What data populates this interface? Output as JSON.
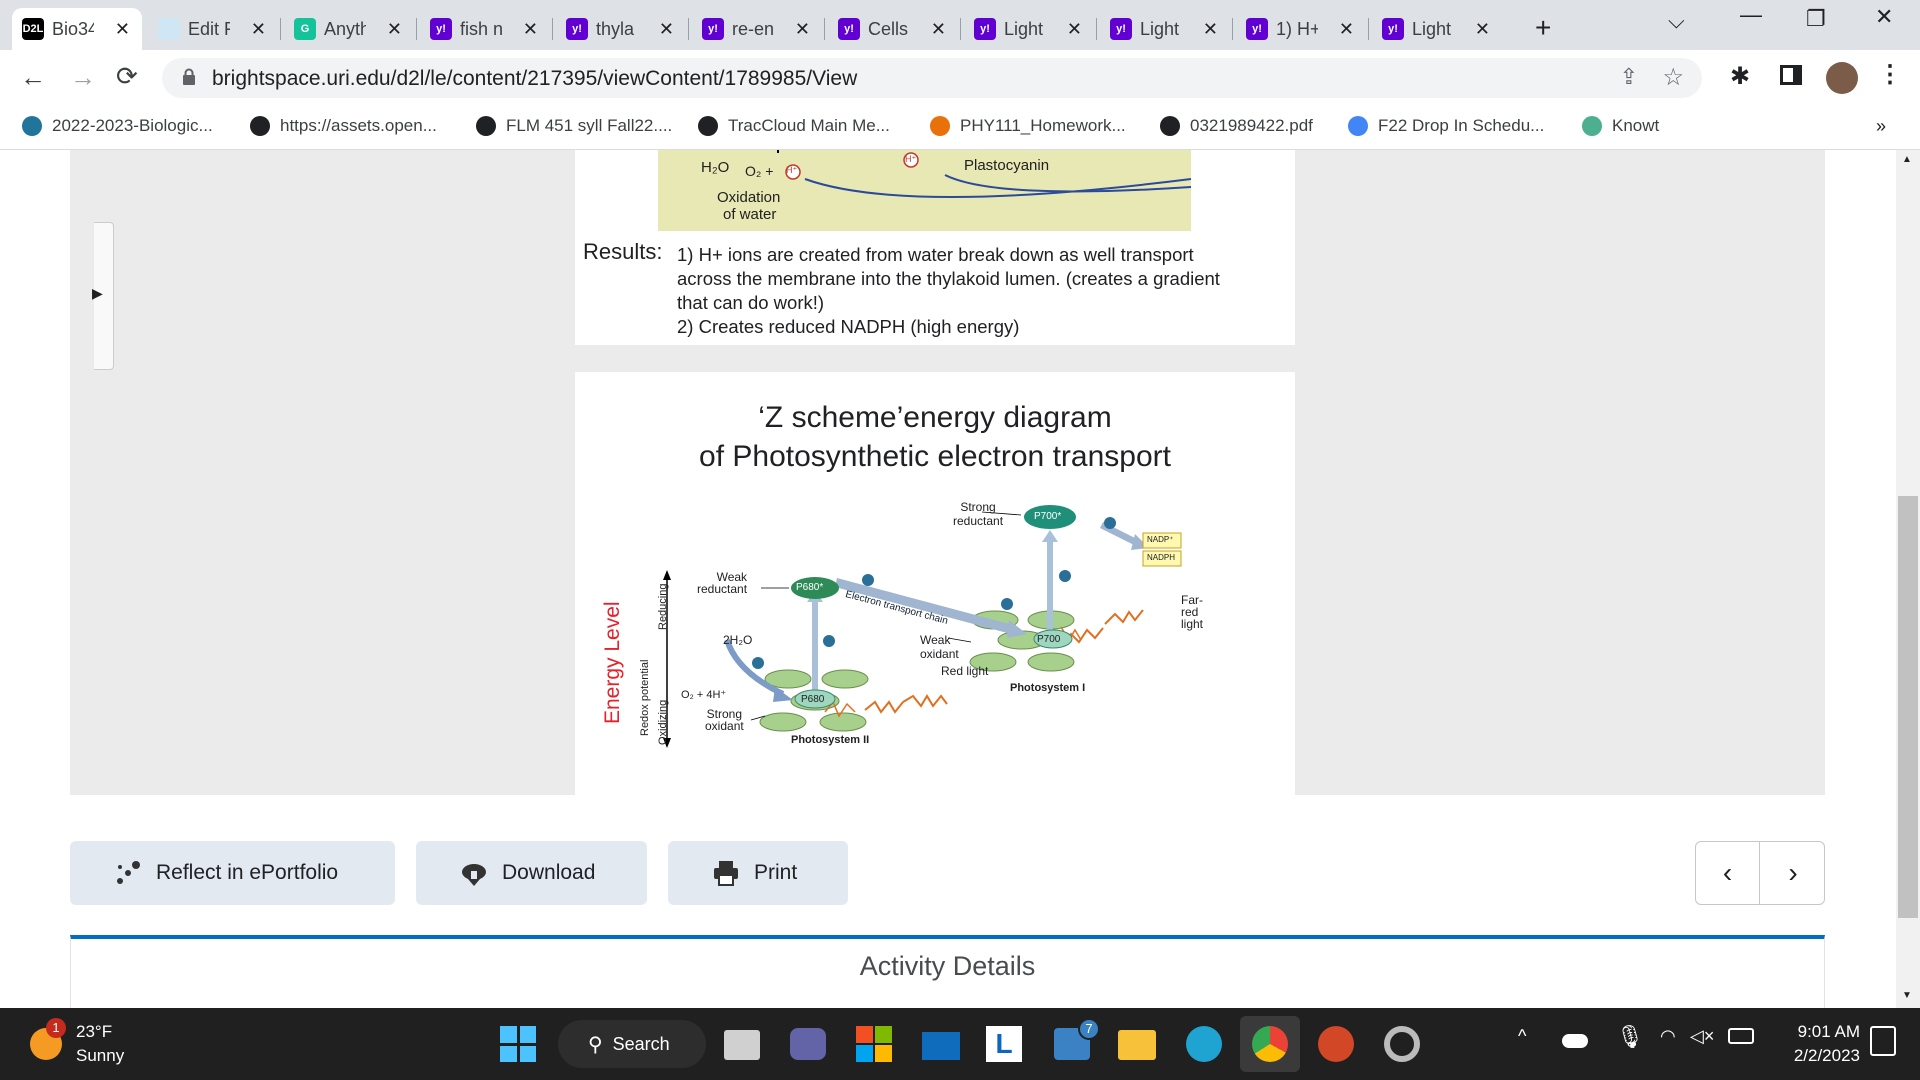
{
  "tabs": [
    {
      "title": "Bio34",
      "fav": "D2L",
      "favColor": "#000000",
      "active": true
    },
    {
      "title": "Edit F",
      "fav": "",
      "favColor": "#cfe6f5"
    },
    {
      "title": "Anyth",
      "fav": "G",
      "favColor": "#15c39a"
    },
    {
      "title": "fish n",
      "fav": "y!",
      "favColor": "#6001d2"
    },
    {
      "title": "thyla",
      "fav": "y!",
      "favColor": "#6001d2"
    },
    {
      "title": "re-en",
      "fav": "y!",
      "favColor": "#6001d2"
    },
    {
      "title": "Cells",
      "fav": "y!",
      "favColor": "#6001d2"
    },
    {
      "title": "Light",
      "fav": "y!",
      "favColor": "#6001d2"
    },
    {
      "title": "Light",
      "fav": "y!",
      "favColor": "#6001d2"
    },
    {
      "title": "1) H+",
      "fav": "y!",
      "favColor": "#6001d2"
    },
    {
      "title": "Light",
      "fav": "y!",
      "favColor": "#6001d2"
    }
  ],
  "browser": {
    "url": "brightspace.uri.edu/d2l/le/content/217395/viewContent/1789985/View",
    "back": "←",
    "forward": "→",
    "reload": "C"
  },
  "bookmarks": [
    {
      "label": "2022-2023-Biologic...",
      "color": "#21759b"
    },
    {
      "label": "https://assets.open...",
      "color": "#202124"
    },
    {
      "label": "FLM 451 syll Fall22....",
      "color": "#202124"
    },
    {
      "label": "TracCloud Main Me...",
      "color": "#202124"
    },
    {
      "label": "PHY111_Homework...",
      "color": "#e8710a"
    },
    {
      "label": "0321989422.pdf",
      "color": "#202124"
    },
    {
      "label": "F22 Drop In Schedu...",
      "color": "#4285f4"
    },
    {
      "label": "Knowt",
      "color": "#4caf8f"
    }
  ],
  "slide1": {
    "h2o": "H₂O",
    "o2": "O₂ +",
    "hplus": "H⁺",
    "plastocyanin": "Plastocyanin",
    "oxidation": "Oxidation",
    "of_water": "of water",
    "results_label": "Results:",
    "results_line1": "1) H+ ions are created from water break down as well transport",
    "results_line2": "across the membrane into the thylakoid lumen. (creates a gradient",
    "results_line3": "that can do work!)",
    "results_line4": "2)  Creates reduced  NADPH (high energy)"
  },
  "slide2": {
    "title1": "‘Z scheme’energy diagram",
    "title2": "of Photosynthetic electron transport",
    "energy_level": "Energy Level",
    "redox": "Redox potential",
    "reducing": "Reducing",
    "oxidizing": "Oxidizing",
    "weak_reductant": "Weak",
    "weak_reductant2": "reductant",
    "p680star": "P680*",
    "etc": "Electron transport chain",
    "h2o": "2H₂O",
    "o2": "O₂ + 4H⁺",
    "strong_oxidant": "Strong",
    "strong_oxidant2": "oxidant",
    "p680": "P680",
    "ps2": "Photosystem II",
    "weak_oxidant": "Weak",
    "weak_oxidant2": "oxidant",
    "red_light": "Red light",
    "p700": "P700",
    "ps1": "Photosystem I",
    "strong_reductant": "Strong",
    "strong_reductant2": "reductant",
    "p700star": "P700*",
    "nadp": "NADP⁺",
    "nadph": "NADPH",
    "far": "Far-",
    "red": "red",
    "light": "light",
    "eminus": "e⁻"
  },
  "actions": {
    "reflect": "Reflect in ePortfolio",
    "download": "Download",
    "print": "Print"
  },
  "activity": {
    "title": "Activity Details"
  },
  "weather": {
    "temp": "23°F",
    "condition": "Sunny",
    "badge": "1"
  },
  "taskbar": {
    "search": "Search",
    "badge": "7"
  },
  "clock": {
    "time": "9:01 AM",
    "date": "2/2/2023"
  }
}
